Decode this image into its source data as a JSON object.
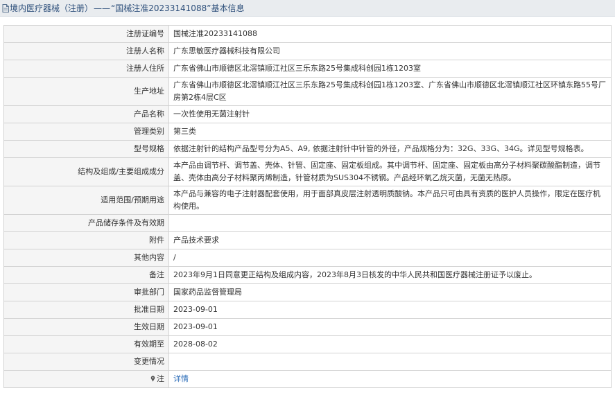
{
  "header": {
    "prefix": "境内医疗器械（注册）",
    "separator": "——",
    "cert_title": "“国械注准20233141088”",
    "suffix": "基本信息"
  },
  "fields": {
    "reg_no": {
      "label": "注册证编号",
      "value": "国械注准20233141088"
    },
    "registrant": {
      "label": "注册人名称",
      "value": "广东思敏医疗器械科技有限公司"
    },
    "address": {
      "label": "注册人住所",
      "value": "广东省佛山市顺德区北滘镇顺江社区三乐东路25号集成科创园1栋1203室"
    },
    "production_site": {
      "label": "生产地址",
      "value": "广东省佛山市顺德区北滘镇顺江社区三乐东路25号集成科创园1栋1203室、广东省佛山市顺德区北滘镇顺江社区环镇东路55号厂房第2栋4层C区"
    },
    "product_name": {
      "label": "产品名称",
      "value": "一次性使用无菌注射针"
    },
    "mgmt_class": {
      "label": "管理类别",
      "value": "第三类"
    },
    "model_spec": {
      "label": "型号规格",
      "value": "依据注射针的结构产品型号分为A5、A9, 依据注射针中针管的外径，产品规格分为：32G、33G、34G。详见型号规格表。"
    },
    "structure": {
      "label": "结构及组成/主要组成成分",
      "value": "本产品由调节杆、调节盖、壳体、针管、固定座、固定板组成。其中调节杆、固定座、固定板由高分子材料聚碳酸酯制造，调节盖、壳体由高分子材料聚丙烯制造，针管材质为SUS304不锈钢。产品经环氧乙烷灭菌，无菌无热原。"
    },
    "scope": {
      "label": "适用范围/预期用途",
      "value": "本产品与兼容的电子注射器配套使用，用于面部真皮层注射透明质酸钠。本产品只可由具有资质的医护人员操作，限定在医疗机构使用。"
    },
    "storage": {
      "label": "产品储存条件及有效期",
      "value": ""
    },
    "attachment": {
      "label": "附件",
      "value": "产品技术要求"
    },
    "other": {
      "label": "其他内容",
      "value": "/"
    },
    "remarks": {
      "label": "备注",
      "value": "2023年9月1日同意更正结构及组成内容，2023年8月3日核发的中华人民共和国医疗器械注册证予以废止。"
    },
    "approval_dept": {
      "label": "审批部门",
      "value": "国家药品监督管理局"
    },
    "approval_date": {
      "label": "批准日期",
      "value": "2023-09-01"
    },
    "effective_date": {
      "label": "生效日期",
      "value": "2023-09-01"
    },
    "expiry_date": {
      "label": "有效期至",
      "value": "2028-08-02"
    },
    "changes": {
      "label": "变更情况",
      "value": ""
    },
    "note": {
      "label": "注",
      "value": "详情"
    }
  },
  "icons": {
    "title": "document-icon",
    "note": "pin-icon"
  },
  "colors": {
    "title_text": "#2c4e7a",
    "link": "#2b6cb8",
    "label_bg": "#f5f5f5",
    "border": "#d2d2d2"
  }
}
